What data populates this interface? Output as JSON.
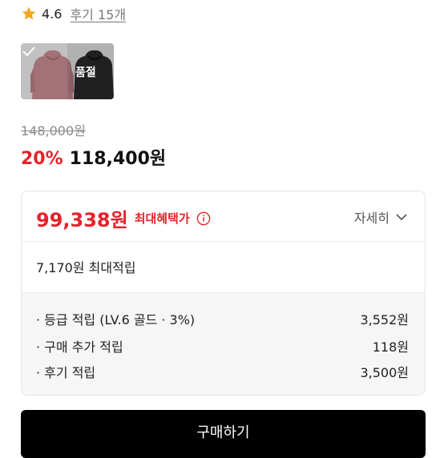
{
  "rating": {
    "score": "4.6",
    "reviews": "후기 15개",
    "star_icon": "star-icon",
    "star_color": "#f5a623"
  },
  "options": [
    {
      "name": "pink-hoodie",
      "color": "#c78a93",
      "selected": true
    },
    {
      "name": "black-hoodie",
      "color": "#2b2b2b",
      "soldout_label": "품절"
    }
  ],
  "price": {
    "original": "148,000원",
    "discount": "20%",
    "sale": "118,400원"
  },
  "benefit": {
    "best_price": "99,338원",
    "best_label": "최대혜택가",
    "detail_label": "자세히",
    "max_points": "7,170원 최대적립",
    "rows": [
      {
        "label": "· 등급 적립 (LV.6 골드 · 3%)",
        "value": "3,552원"
      },
      {
        "label": "· 구매 추가 적립",
        "value": "118원"
      },
      {
        "label": "· 후기 적립",
        "value": "3,500원"
      }
    ],
    "accent_color": "#e4232a"
  },
  "buy_button": "구매하기"
}
